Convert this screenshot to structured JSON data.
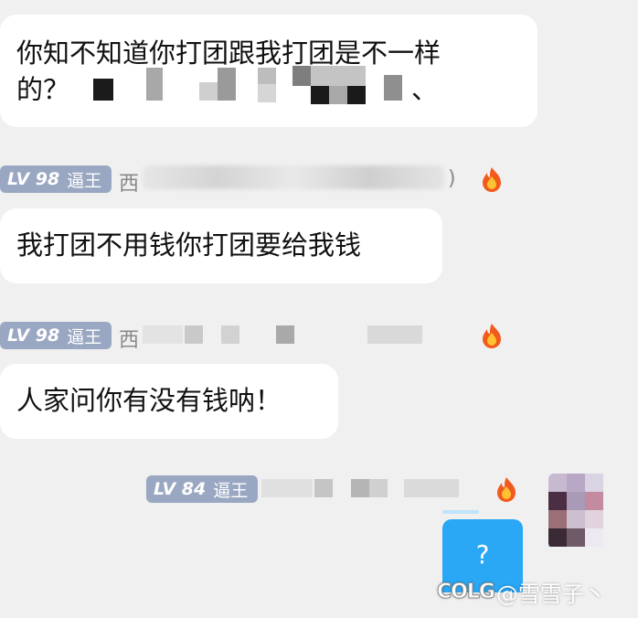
{
  "messages": [
    {
      "line1": "你知不知道你打团跟我打团是不一样",
      "line2_visible": "的？",
      "line2_tail": "、"
    },
    {
      "text": "我打团不用钱你打团要给我钱"
    },
    {
      "text": "人家问你有没有钱呐！"
    }
  ],
  "sender_meta": [
    {
      "level": "LV 98",
      "title": "逼王",
      "name_visible": "西",
      "name_end": ")"
    },
    {
      "level": "LV 98",
      "title": "逼王",
      "name_visible": "西"
    },
    {
      "level": "LV 84",
      "title": "逼王"
    }
  ],
  "image_message": {
    "glyph": "?"
  },
  "watermark": {
    "logo": "COLG",
    "text": "@雪雪子丶"
  },
  "icons": [
    "fire-icon",
    "avatar"
  ],
  "colors": {
    "background": "#f0f0f0",
    "bubble": "#ffffff",
    "badge": "#9aa7c2",
    "image": "#2aa7f5"
  }
}
